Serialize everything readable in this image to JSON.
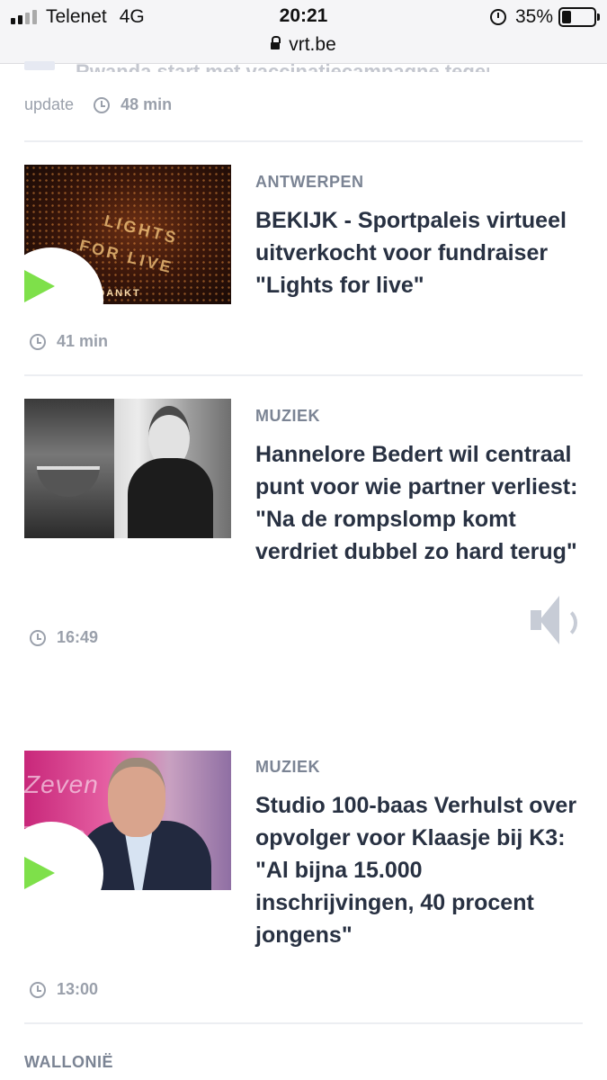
{
  "status_bar": {
    "carrier": "Telenet",
    "network": "4G",
    "time": "20:21",
    "url": "vrt.be",
    "battery": "35%"
  },
  "feed": {
    "top_item": {
      "headline_cut": "Rwanda start met vaccinatiecampagne tegen",
      "update_label": "update",
      "time": "48 min"
    },
    "articles": [
      {
        "category": "ANTWERPEN",
        "headline": "BEKIJK - Sportpaleis virtueel uitverkocht voor fundraiser \"Lights for live\"",
        "time": "41 min",
        "has_video": true,
        "thumb_words": [
          "LIGHTS",
          "FOR LIVE",
          "BEDANKT"
        ]
      },
      {
        "category": "MUZIEK",
        "headline": "Hannelore Bedert wil centraal punt voor wie partner verliest: \"Na de rompslomp komt verdriet dubbel zo hard terug\"",
        "time": "16:49",
        "has_audio": true
      },
      {
        "category": "MUZIEK",
        "headline": "Studio 100-baas Verhulst over opvolger voor Klaasje bij K3: \"Al bijna 15.000 inschrijvingen, 40 procent jongens\"",
        "time": "13:00",
        "has_video": true,
        "thumb_words": [
          "Zeven",
          "Zeven"
        ]
      }
    ],
    "next_section": "WALLONIË"
  }
}
